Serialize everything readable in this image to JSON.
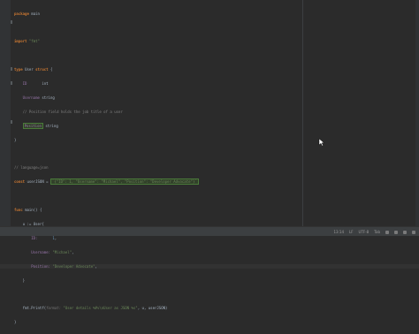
{
  "editor": {
    "lines": [
      {
        "type": "pkg",
        "kw": "package",
        "name": "main"
      },
      {
        "type": "blank"
      },
      {
        "type": "import",
        "kw": "import",
        "path": "\"fmt\""
      },
      {
        "type": "blank"
      },
      {
        "type": "typedef",
        "kw1": "type",
        "name": "User",
        "kw2": "struct",
        "brace": "{"
      },
      {
        "type": "field",
        "name": "ID",
        "ftype": "int"
      },
      {
        "type": "field",
        "name": "Username",
        "ftype": "string"
      },
      {
        "type": "comment",
        "text": "// Position field holds the job title of a user"
      },
      {
        "type": "field",
        "name": "Position",
        "ftype": "string"
      },
      {
        "type": "close",
        "text": "}"
      },
      {
        "type": "blank"
      },
      {
        "type": "comment",
        "text": "// language=json"
      },
      {
        "type": "const",
        "kw": "const",
        "name": "userJSON",
        "op": "=",
        "value": "`{\"ID\": 1, \"Username\": \"Michael\", \"Position\": \"Developer Advocate\"}`"
      },
      {
        "type": "blank"
      },
      {
        "type": "func",
        "kw": "func",
        "name": "main()",
        "brace": "{"
      },
      {
        "type": "assign",
        "lhs": "u",
        "op": ":=",
        "rhs": "User{"
      },
      {
        "type": "kv",
        "key": "ID:",
        "val": "1",
        "val_kind": "num"
      },
      {
        "type": "kv",
        "key": "Username:",
        "val": "\"Michael\"",
        "val_kind": "str"
      },
      {
        "type": "kv",
        "key": "Position:",
        "val": "\"Developer Advocate\"",
        "val_kind": "str"
      },
      {
        "type": "close",
        "text": "}"
      },
      {
        "type": "blank"
      },
      {
        "type": "call",
        "pkg": "fmt.Printf(",
        "hint": "format:",
        "arg": "\"User details %#v\\nUser as JSON %s\"",
        "rest": ", u, userJSON)"
      },
      {
        "type": "close",
        "text": "}"
      }
    ]
  },
  "statusbar": {
    "position": "13:14",
    "line_sep": "LF",
    "encoding": "UTF-8",
    "indent": "Tab"
  }
}
